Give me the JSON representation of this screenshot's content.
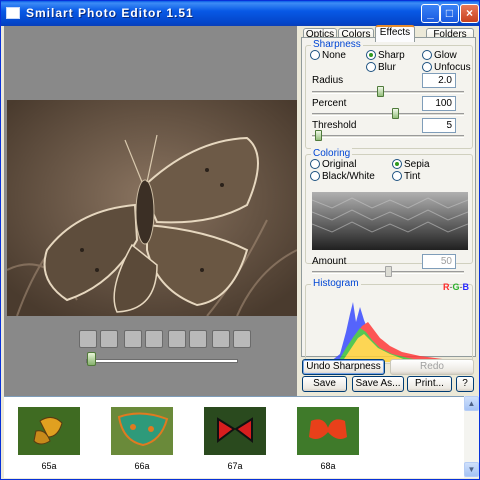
{
  "window": {
    "title": "Smilart Photo Editor 1.51",
    "min": "_",
    "max": "□",
    "close": "×"
  },
  "tabs": [
    {
      "label": "Optics",
      "active": false
    },
    {
      "label": "Colors",
      "active": false
    },
    {
      "label": "Effects",
      "active": true
    },
    {
      "label": "Folders",
      "active": false
    }
  ],
  "sharpness": {
    "title": "Sharpness",
    "options": {
      "none": "None",
      "sharp": "Sharp",
      "glow": "Glow",
      "blur": "Blur",
      "unfocus": "Unfocus"
    },
    "selected": "Sharp",
    "radius": {
      "label": "Radius",
      "value": "2.0",
      "level": 0.45
    },
    "percent": {
      "label": "Percent",
      "value": "100",
      "level": 0.55
    },
    "threshold": {
      "label": "Threshold",
      "value": "5",
      "level": 0.02
    }
  },
  "coloring": {
    "title": "Coloring",
    "options": {
      "original": "Original",
      "sepia": "Sepia",
      "bw": "Black/White",
      "tint": "Tint"
    },
    "selected": "Sepia",
    "amount": {
      "label": "Amount",
      "value": "50",
      "level": 0.5
    }
  },
  "histogram": {
    "title": "Histogram",
    "r": "R",
    "g": "G",
    "b": "B",
    "sep": "-",
    "colors": {
      "r": "#ff2a2a",
      "g": "#2ab02a",
      "b": "#2a2aff"
    }
  },
  "buttons": {
    "undo": "Undo Sharpness",
    "redo": "Redo",
    "save": "Save",
    "save_as": "Save As...",
    "print": "Print...",
    "help": "?"
  },
  "preview": {
    "zoom_level": 0.02
  },
  "toolbar_icons": [
    "fit-page-icon",
    "actual-size-icon",
    "zoom-in-icon",
    "zoom-out-icon",
    "rotate-left-icon",
    "rotate-right-icon",
    "crop-icon",
    "fullscreen-icon"
  ],
  "thumbnails": [
    {
      "caption": "65a"
    },
    {
      "caption": "66a"
    },
    {
      "caption": "67a"
    },
    {
      "caption": "68a"
    }
  ],
  "scroll": {
    "up": "▲",
    "down": "▼"
  }
}
